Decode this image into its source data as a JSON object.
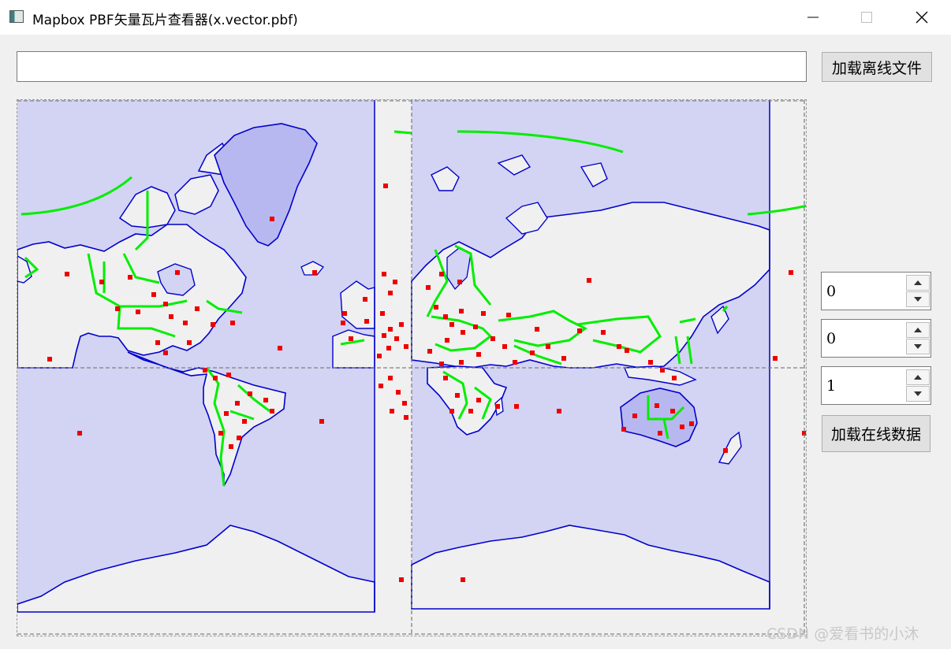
{
  "window": {
    "title": "Mapbox PBF矢量瓦片查看器(x.vector.pbf)",
    "icon": "window-app-icon",
    "controls": [
      "minimize-icon",
      "maximize-icon",
      "close-icon"
    ]
  },
  "toolbar": {
    "url_value": "",
    "load_offline_label": "加载离线文件"
  },
  "map": {
    "water_color": "#d3d3f3",
    "land_color": "#f0f0f0",
    "coast_color": "#0000cc",
    "boundary_color": "#00ee00",
    "place_color": "#ee0000",
    "tile_border_color": "#808080"
  },
  "tile": {
    "z": {
      "value": "0"
    },
    "x": {
      "value": "0"
    },
    "y": {
      "value": "1"
    },
    "load_online_label": "加载在线数据"
  },
  "watermark": "CSDN @爱看书的小沐"
}
